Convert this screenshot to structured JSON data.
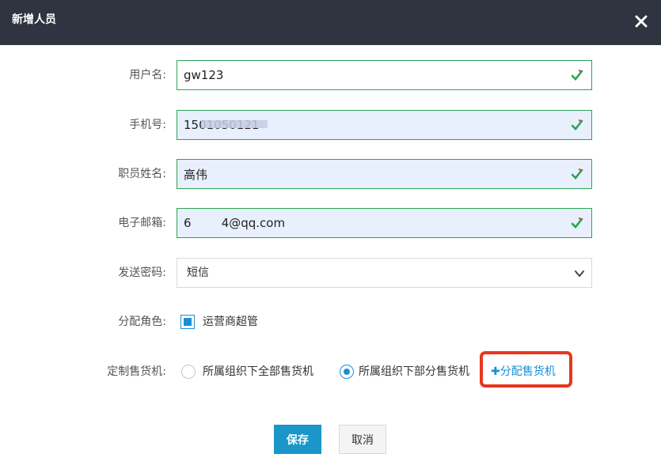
{
  "dialog": {
    "title": "新增人员"
  },
  "form": {
    "username": {
      "label": "用户名:",
      "value": "gw123"
    },
    "phone": {
      "label": "手机号:",
      "value": "1501050121"
    },
    "staff_name": {
      "label": "职员姓名:",
      "value": "高伟"
    },
    "email": {
      "label": "电子邮箱:",
      "value": "6        4@qq.com"
    },
    "send_password": {
      "label": "发送密码:",
      "selected": "短信"
    },
    "role": {
      "label": "分配角色:",
      "option": "运营商超管",
      "checked": true
    },
    "vending": {
      "label": "定制售货机:",
      "options": [
        "所属组织下全部售货机",
        "所属组织下部分售货机"
      ],
      "selected_index": 1,
      "assign_link": "分配售货机",
      "assign_plus": "✚"
    }
  },
  "actions": {
    "save_label": "保存",
    "cancel_label": "取消"
  },
  "colors": {
    "header_bg": "#2f3440",
    "valid_border": "#2aa552",
    "accent": "#1a8fd6",
    "save_bg": "#1a96c9",
    "highlight": "#e8361f"
  },
  "icons": {
    "close": "close-icon",
    "valid": "valid-check-icon",
    "dropdown": "chevron-down-icon"
  }
}
